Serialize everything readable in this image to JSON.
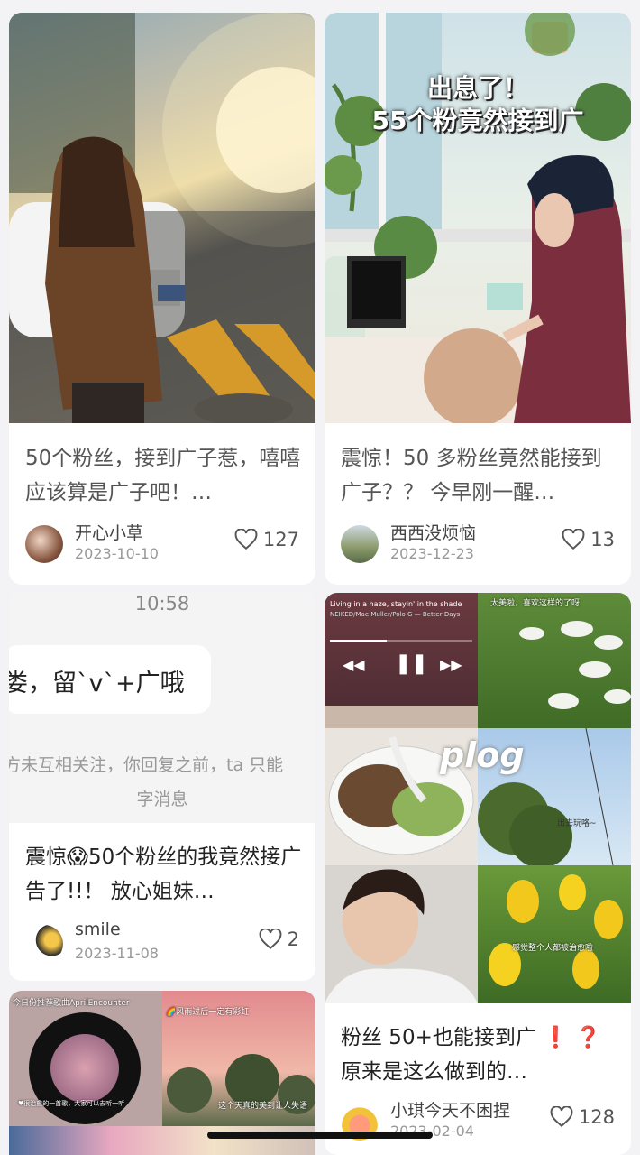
{
  "cards": [
    {
      "title": "50个粉丝，接到广子惹，嘻嘻 应该算是广子吧！…",
      "author": "开心小草",
      "date": "2023-10-10",
      "likes": "127"
    },
    {
      "title": "震惊！50 多粉丝竟然能接到广子？？ 今早刚一醒…",
      "author": "西西没烦恼",
      "date": "2023-12-23",
      "likes": "13",
      "cover_text_line1": "出息了！",
      "cover_text_line2": "55个粉竟然接到广"
    },
    {
      "title": "震惊😱50个粉丝的我竟然接广告了!!！ 放心姐妹…",
      "author": "smile",
      "date": "2023-11-08",
      "likes": "2",
      "cover_time": "10:58",
      "cover_bubble": "娄，留`v`+广哦",
      "cover_notice_line1": "方未互相关注，你回复之前，ta 只能",
      "cover_notice_line2": "字消息"
    },
    {
      "title": "粉丝 50+也能接到广 ❗ ❓ 原来是这么做到的…",
      "author": "小琪今天不困捏",
      "date": "2023-02-04",
      "likes": "128",
      "cover_song": "Living in a haze, stayin' in the shade",
      "cover_artist": "NEIKED/Mae Muller/Polo G — Better Days",
      "cover_plog": "plog",
      "cover_caption_geese": "太美啦，喜欢这样的了呀",
      "cover_caption_walk": "出去玩咯~",
      "cover_caption_tulip": "感觉整个人都被治愈啦"
    },
    {
      "cover_caption_left": "今日份推荐歌曲AprilEncounter",
      "cover_caption_left_bottom": "♥很治愈的一首歌，大家可以去听一听",
      "cover_caption_right": "🌈风雨过后一定有彩虹",
      "cover_caption_right_bottom": "这个天真的美到让人失语"
    }
  ],
  "colors": {
    "background": "#f3f3f5",
    "card": "#ffffff",
    "text": "#222222",
    "muted": "#999999",
    "heart": "#555555"
  }
}
